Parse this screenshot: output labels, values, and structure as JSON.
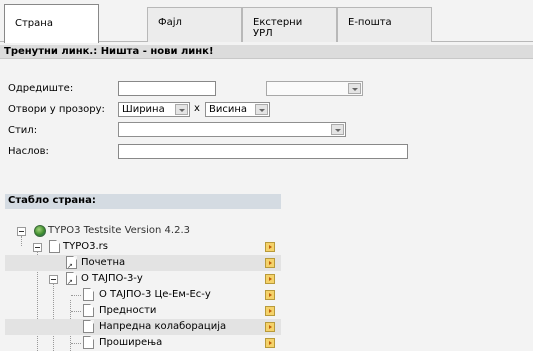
{
  "tabs": [
    {
      "label": "Страна",
      "active": true
    },
    {
      "label": "Фајл",
      "active": false
    },
    {
      "label": "Екстерни УРЛ",
      "active": false
    },
    {
      "label": "Е-пошта",
      "active": false
    }
  ],
  "current_link": "Тренутни линк.: Ништа - нови линк!",
  "form": {
    "target_label": "Одредиште:",
    "target_value": "",
    "target_select": "",
    "window_label": "Отвори у прозору:",
    "width_select": "Ширина",
    "times": "x",
    "height_select": "Висина",
    "style_label": "Стил:",
    "style_select": "",
    "title_label": "Наслов:",
    "title_value": ""
  },
  "tree": {
    "header": "Стабло страна:",
    "root": "TYPO3 Testsite Version 4.2.3",
    "site": "TYPO3.rs",
    "items": [
      "Почетна",
      "О ТАЈПО-3-у",
      "О ТАЈПО-3 Це-Ем-Ес-у",
      "Предности",
      "Напредна колаборација",
      "Проширења"
    ]
  }
}
